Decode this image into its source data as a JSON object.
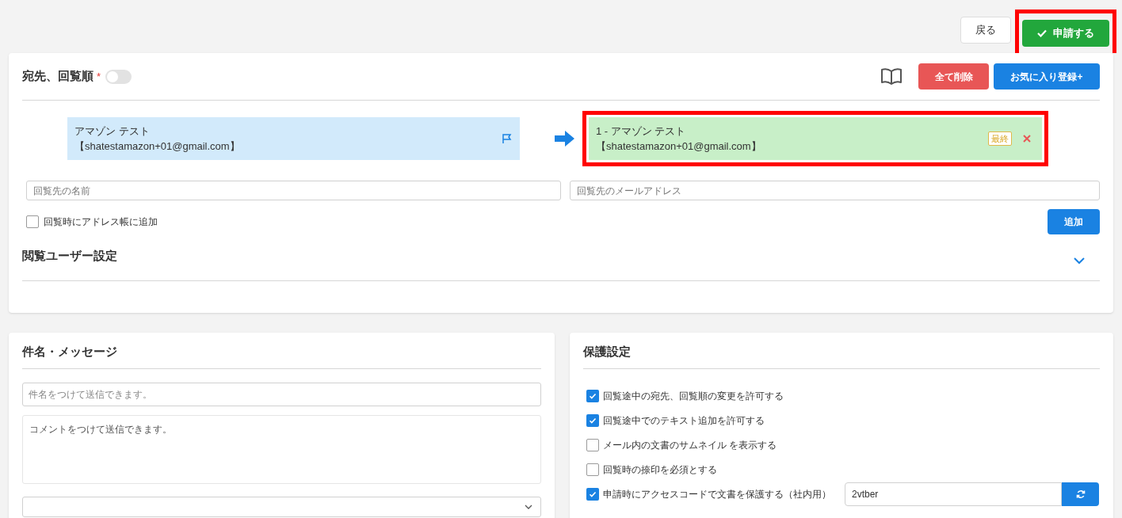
{
  "header": {
    "buttons": [
      {
        "label": "戻る",
        "kind": "secondary",
        "highlighted": false
      },
      {
        "label": "申請する",
        "kind": "primary",
        "highlighted": true
      }
    ]
  },
  "recipients": {
    "title": "宛先、回覧順",
    "required_mark": "*",
    "toggle": {
      "on": false
    },
    "actions": [
      {
        "label": "全て削除",
        "kind": "danger"
      },
      {
        "label": "お気に入り登録+",
        "kind": "primary"
      }
    ],
    "address_book": [
      {
        "name": "アマゾン テスト",
        "email": "【shatestamazon+01@gmail.com】"
      }
    ],
    "route": [
      {
        "label": "1 - アマゾン テスト",
        "email": "【shatestamazon+01@gmail.com】",
        "badge": "最終",
        "highlighted": true
      }
    ],
    "name_field": {
      "placeholder": "回覧先の名前"
    },
    "email_field": {
      "placeholder": "回覧先のメールアドレス"
    },
    "address_book_checkbox": {
      "label": "回覧時にアドレス帳に追加",
      "checked": false
    },
    "add_button": "追加",
    "viewer_settings": {
      "title": "閲覧ユーザー設定",
      "expanded": false
    }
  },
  "message": {
    "title": "件名・メッセージ",
    "subject": {
      "placeholder": "件名をつけて送信できます。"
    },
    "comment": {
      "placeholder": "コメントをつけて送信できます。"
    }
  },
  "protection": {
    "title": "保護設定",
    "options": [
      {
        "label": "回覧途中の宛先、回覧順の変更を許可する",
        "checked": true
      },
      {
        "label": "回覧途中でのテキスト追加を許可する",
        "checked": true
      },
      {
        "label": "メール内の文書のサムネイル を表示する",
        "checked": false
      },
      {
        "label": "回覧時の捺印を必須とする",
        "checked": false
      },
      {
        "label": "申請時にアクセスコードで文書を保護する（社内用）",
        "checked": true
      }
    ],
    "access_code": {
      "value": "2vtber"
    }
  }
}
